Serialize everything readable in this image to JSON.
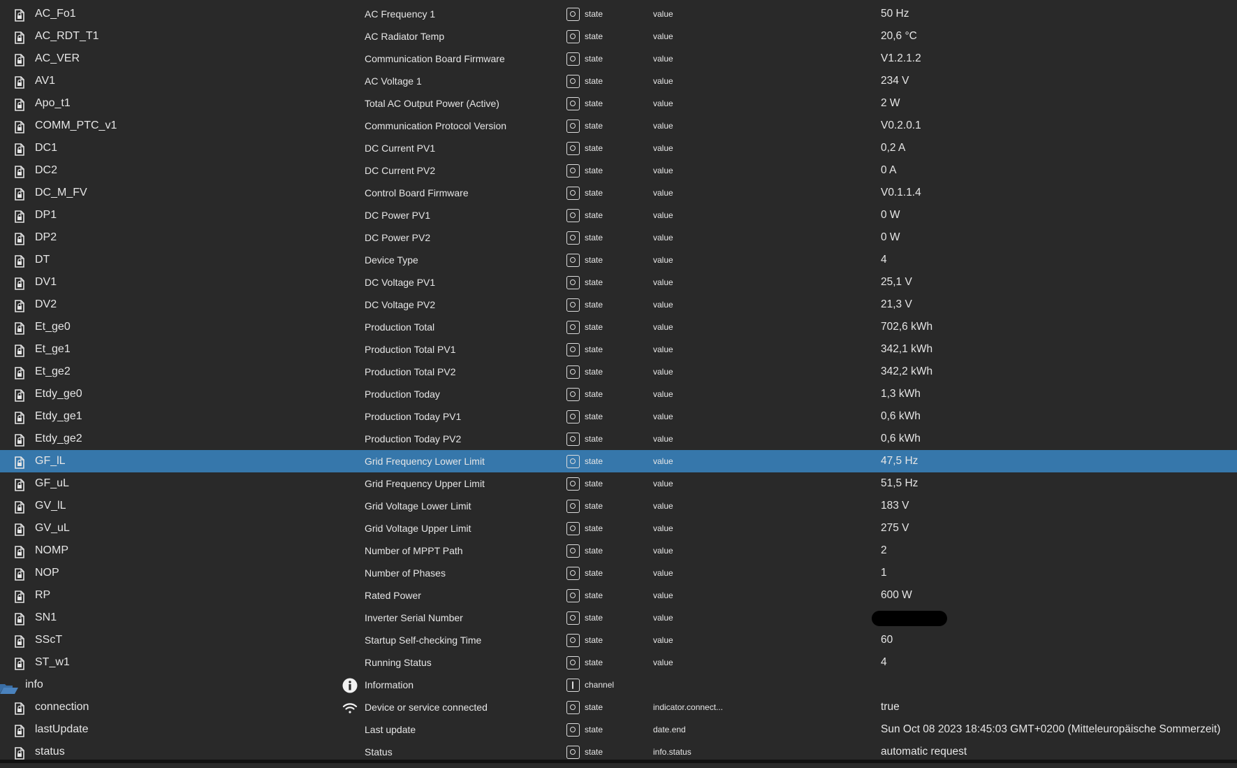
{
  "colors": {
    "background": "#292929",
    "selected_row": "#3677ab",
    "folder": "#3a6ea5"
  },
  "selected_index": 20,
  "rows": [
    {
      "name": "AC_Fo1",
      "desc": "AC Frequency 1",
      "type": "state",
      "role": "value",
      "value": "50 Hz",
      "icon": "file-lock-icon"
    },
    {
      "name": "AC_RDT_T1",
      "desc": "AC Radiator Temp",
      "type": "state",
      "role": "value",
      "value": "20,6 °C",
      "icon": "file-lock-icon"
    },
    {
      "name": "AC_VER",
      "desc": "Communication Board Firmware",
      "type": "state",
      "role": "value",
      "value": "V1.2.1.2",
      "icon": "file-lock-icon"
    },
    {
      "name": "AV1",
      "desc": "AC Voltage 1",
      "type": "state",
      "role": "value",
      "value": "234 V",
      "icon": "file-lock-icon"
    },
    {
      "name": "Apo_t1",
      "desc": "Total AC Output Power (Active)",
      "type": "state",
      "role": "value",
      "value": "2 W",
      "icon": "file-lock-icon"
    },
    {
      "name": "COMM_PTC_v1",
      "desc": "Communication Protocol Version",
      "type": "state",
      "role": "value",
      "value": "V0.2.0.1",
      "icon": "file-lock-icon"
    },
    {
      "name": "DC1",
      "desc": "DC Current PV1",
      "type": "state",
      "role": "value",
      "value": "0,2 A",
      "icon": "file-lock-icon"
    },
    {
      "name": "DC2",
      "desc": "DC Current PV2",
      "type": "state",
      "role": "value",
      "value": "0 A",
      "icon": "file-lock-icon"
    },
    {
      "name": "DC_M_FV",
      "desc": "Control Board Firmware",
      "type": "state",
      "role": "value",
      "value": "V0.1.1.4",
      "icon": "file-lock-icon"
    },
    {
      "name": "DP1",
      "desc": "DC Power PV1",
      "type": "state",
      "role": "value",
      "value": "0 W",
      "icon": "file-lock-icon"
    },
    {
      "name": "DP2",
      "desc": "DC Power PV2",
      "type": "state",
      "role": "value",
      "value": "0 W",
      "icon": "file-lock-icon"
    },
    {
      "name": "DT",
      "desc": "Device Type",
      "type": "state",
      "role": "value",
      "value": "4",
      "icon": "file-lock-icon"
    },
    {
      "name": "DV1",
      "desc": "DC Voltage PV1",
      "type": "state",
      "role": "value",
      "value": "25,1 V",
      "icon": "file-lock-icon"
    },
    {
      "name": "DV2",
      "desc": "DC Voltage PV2",
      "type": "state",
      "role": "value",
      "value": "21,3 V",
      "icon": "file-lock-icon"
    },
    {
      "name": "Et_ge0",
      "desc": "Production Total",
      "type": "state",
      "role": "value",
      "value": "702,6 kWh",
      "icon": "file-lock-icon"
    },
    {
      "name": "Et_ge1",
      "desc": "Production Total PV1",
      "type": "state",
      "role": "value",
      "value": "342,1 kWh",
      "icon": "file-lock-icon"
    },
    {
      "name": "Et_ge2",
      "desc": "Production Total PV2",
      "type": "state",
      "role": "value",
      "value": "342,2 kWh",
      "icon": "file-lock-icon"
    },
    {
      "name": "Etdy_ge0",
      "desc": "Production Today",
      "type": "state",
      "role": "value",
      "value": "1,3 kWh",
      "icon": "file-lock-icon"
    },
    {
      "name": "Etdy_ge1",
      "desc": "Production Today PV1",
      "type": "state",
      "role": "value",
      "value": "0,6 kWh",
      "icon": "file-lock-icon"
    },
    {
      "name": "Etdy_ge2",
      "desc": "Production Today PV2",
      "type": "state",
      "role": "value",
      "value": "0,6 kWh",
      "icon": "file-lock-icon"
    },
    {
      "name": "GF_lL",
      "desc": "Grid Frequency Lower Limit",
      "type": "state",
      "role": "value",
      "value": "47,5 Hz",
      "icon": "file-lock-icon"
    },
    {
      "name": "GF_uL",
      "desc": "Grid Frequency Upper Limit",
      "type": "state",
      "role": "value",
      "value": "51,5 Hz",
      "icon": "file-lock-icon"
    },
    {
      "name": "GV_lL",
      "desc": "Grid Voltage Lower Limit",
      "type": "state",
      "role": "value",
      "value": "183 V",
      "icon": "file-lock-icon"
    },
    {
      "name": "GV_uL",
      "desc": "Grid Voltage Upper Limit",
      "type": "state",
      "role": "value",
      "value": "275 V",
      "icon": "file-lock-icon"
    },
    {
      "name": "NOMP",
      "desc": "Number of MPPT Path",
      "type": "state",
      "role": "value",
      "value": "2",
      "icon": "file-lock-icon"
    },
    {
      "name": "NOP",
      "desc": "Number of Phases",
      "type": "state",
      "role": "value",
      "value": "1",
      "icon": "file-lock-icon"
    },
    {
      "name": "RP",
      "desc": "Rated Power",
      "type": "state",
      "role": "value",
      "value": "600 W",
      "icon": "file-lock-icon"
    },
    {
      "name": "SN1",
      "desc": "Inverter Serial Number",
      "type": "state",
      "role": "value",
      "value": "",
      "redacted": true,
      "icon": "file-lock-icon"
    },
    {
      "name": "SScT",
      "desc": "Startup Self-checking Time",
      "type": "state",
      "role": "value",
      "value": "60",
      "icon": "file-lock-icon"
    },
    {
      "name": "ST_w1",
      "desc": "Running Status",
      "type": "state",
      "role": "value",
      "value": "4",
      "icon": "file-lock-icon"
    },
    {
      "name": "info",
      "desc": "Information",
      "type": "channel",
      "role": "",
      "value": "",
      "icon": "folder-open-icon",
      "desc_icon": "info-icon"
    },
    {
      "name": "connection",
      "desc": "Device or service connected",
      "type": "state",
      "role": "indicator.connect...",
      "value": "true",
      "icon": "file-lock-icon",
      "desc_icon": "wifi-icon"
    },
    {
      "name": "lastUpdate",
      "desc": "Last update",
      "type": "state",
      "role": "date.end",
      "value": "Sun Oct 08 2023 18:45:03 GMT+0200 (Mitteleuropäische Sommerzeit)",
      "icon": "file-lock-icon"
    },
    {
      "name": "status",
      "desc": "Status",
      "type": "state",
      "role": "info.status",
      "value": "automatic request",
      "icon": "file-lock-icon"
    }
  ]
}
